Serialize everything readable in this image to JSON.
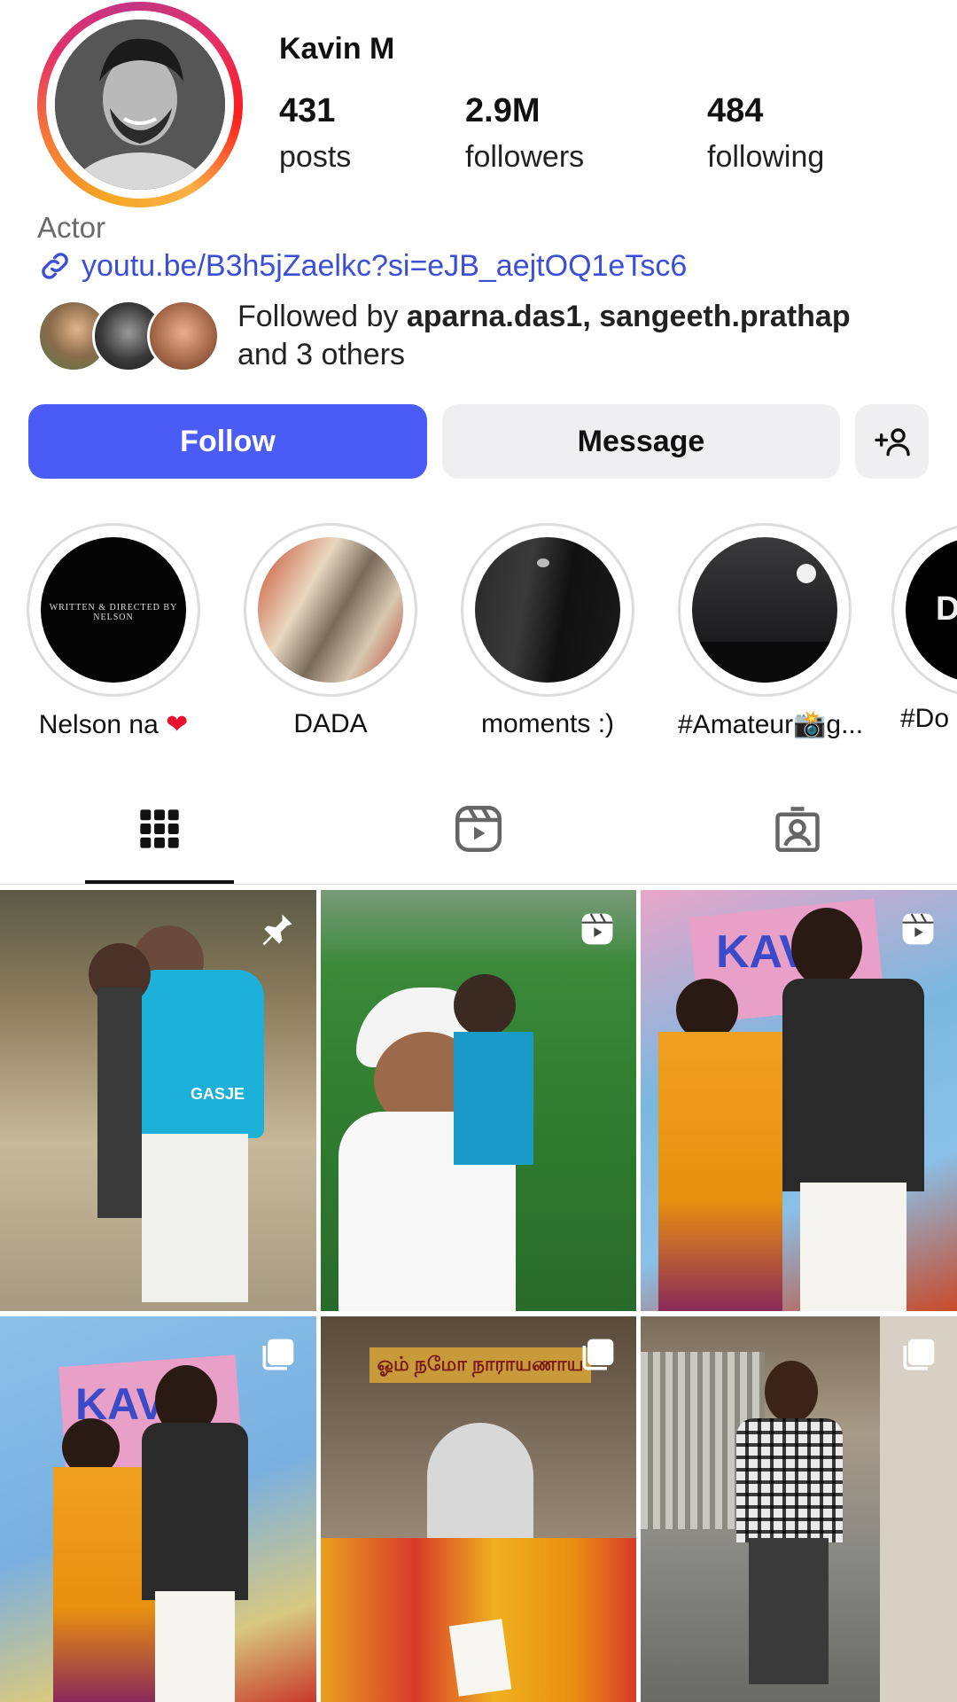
{
  "profile": {
    "username": "Kavin M",
    "bio": "Actor",
    "link": "youtu.be/B3h5jZaelkc?si=eJB_aejtOQ1eTsc6",
    "stats": [
      {
        "value": "431",
        "label": "posts"
      },
      {
        "value": "2.9M",
        "label": "followers"
      },
      {
        "value": "484",
        "label": "following"
      }
    ],
    "followed_by": {
      "prefix": "Followed by ",
      "names": "aparna.das1, sangeeth.prathap",
      "suffix": "and 3 others"
    }
  },
  "actions": {
    "follow": "Follow",
    "message": "Message",
    "add_user_icon": "person-add-icon"
  },
  "highlights": [
    {
      "label": "Nelson na",
      "emoji": "❤",
      "cover_text": "WRITTEN & DIRECTED BY NELSON"
    },
    {
      "label": "DADA",
      "emoji": "",
      "cover_text": ""
    },
    {
      "label": "moments :)",
      "emoji": "",
      "cover_text": ""
    },
    {
      "label": "#Amateur📸g...",
      "emoji": "",
      "cover_text": ""
    },
    {
      "label": "#Do",
      "emoji": "",
      "cover_text": "DO"
    }
  ],
  "tabs": [
    {
      "name": "posts-grid",
      "icon": "grid-icon",
      "active": true
    },
    {
      "name": "reels",
      "icon": "reels-icon",
      "active": false
    },
    {
      "name": "tagged",
      "icon": "tagged-person-icon",
      "active": false
    }
  ],
  "posts": [
    {
      "badge": "pin-icon",
      "caption_text": "GASJE"
    },
    {
      "badge": "reel-icon",
      "caption_text": ""
    },
    {
      "badge": "reel-icon",
      "caption_text": "KAVIN"
    },
    {
      "badge": "carousel-icon",
      "caption_text": "KAVIN"
    },
    {
      "badge": "carousel-icon",
      "caption_text": "ஓம் நமோ நாராயணாய"
    },
    {
      "badge": "carousel-icon",
      "caption_text": ""
    }
  ],
  "colors": {
    "accent": "#4a5cf5",
    "link": "#3b4fd6",
    "secondary_button": "#efeff2"
  }
}
